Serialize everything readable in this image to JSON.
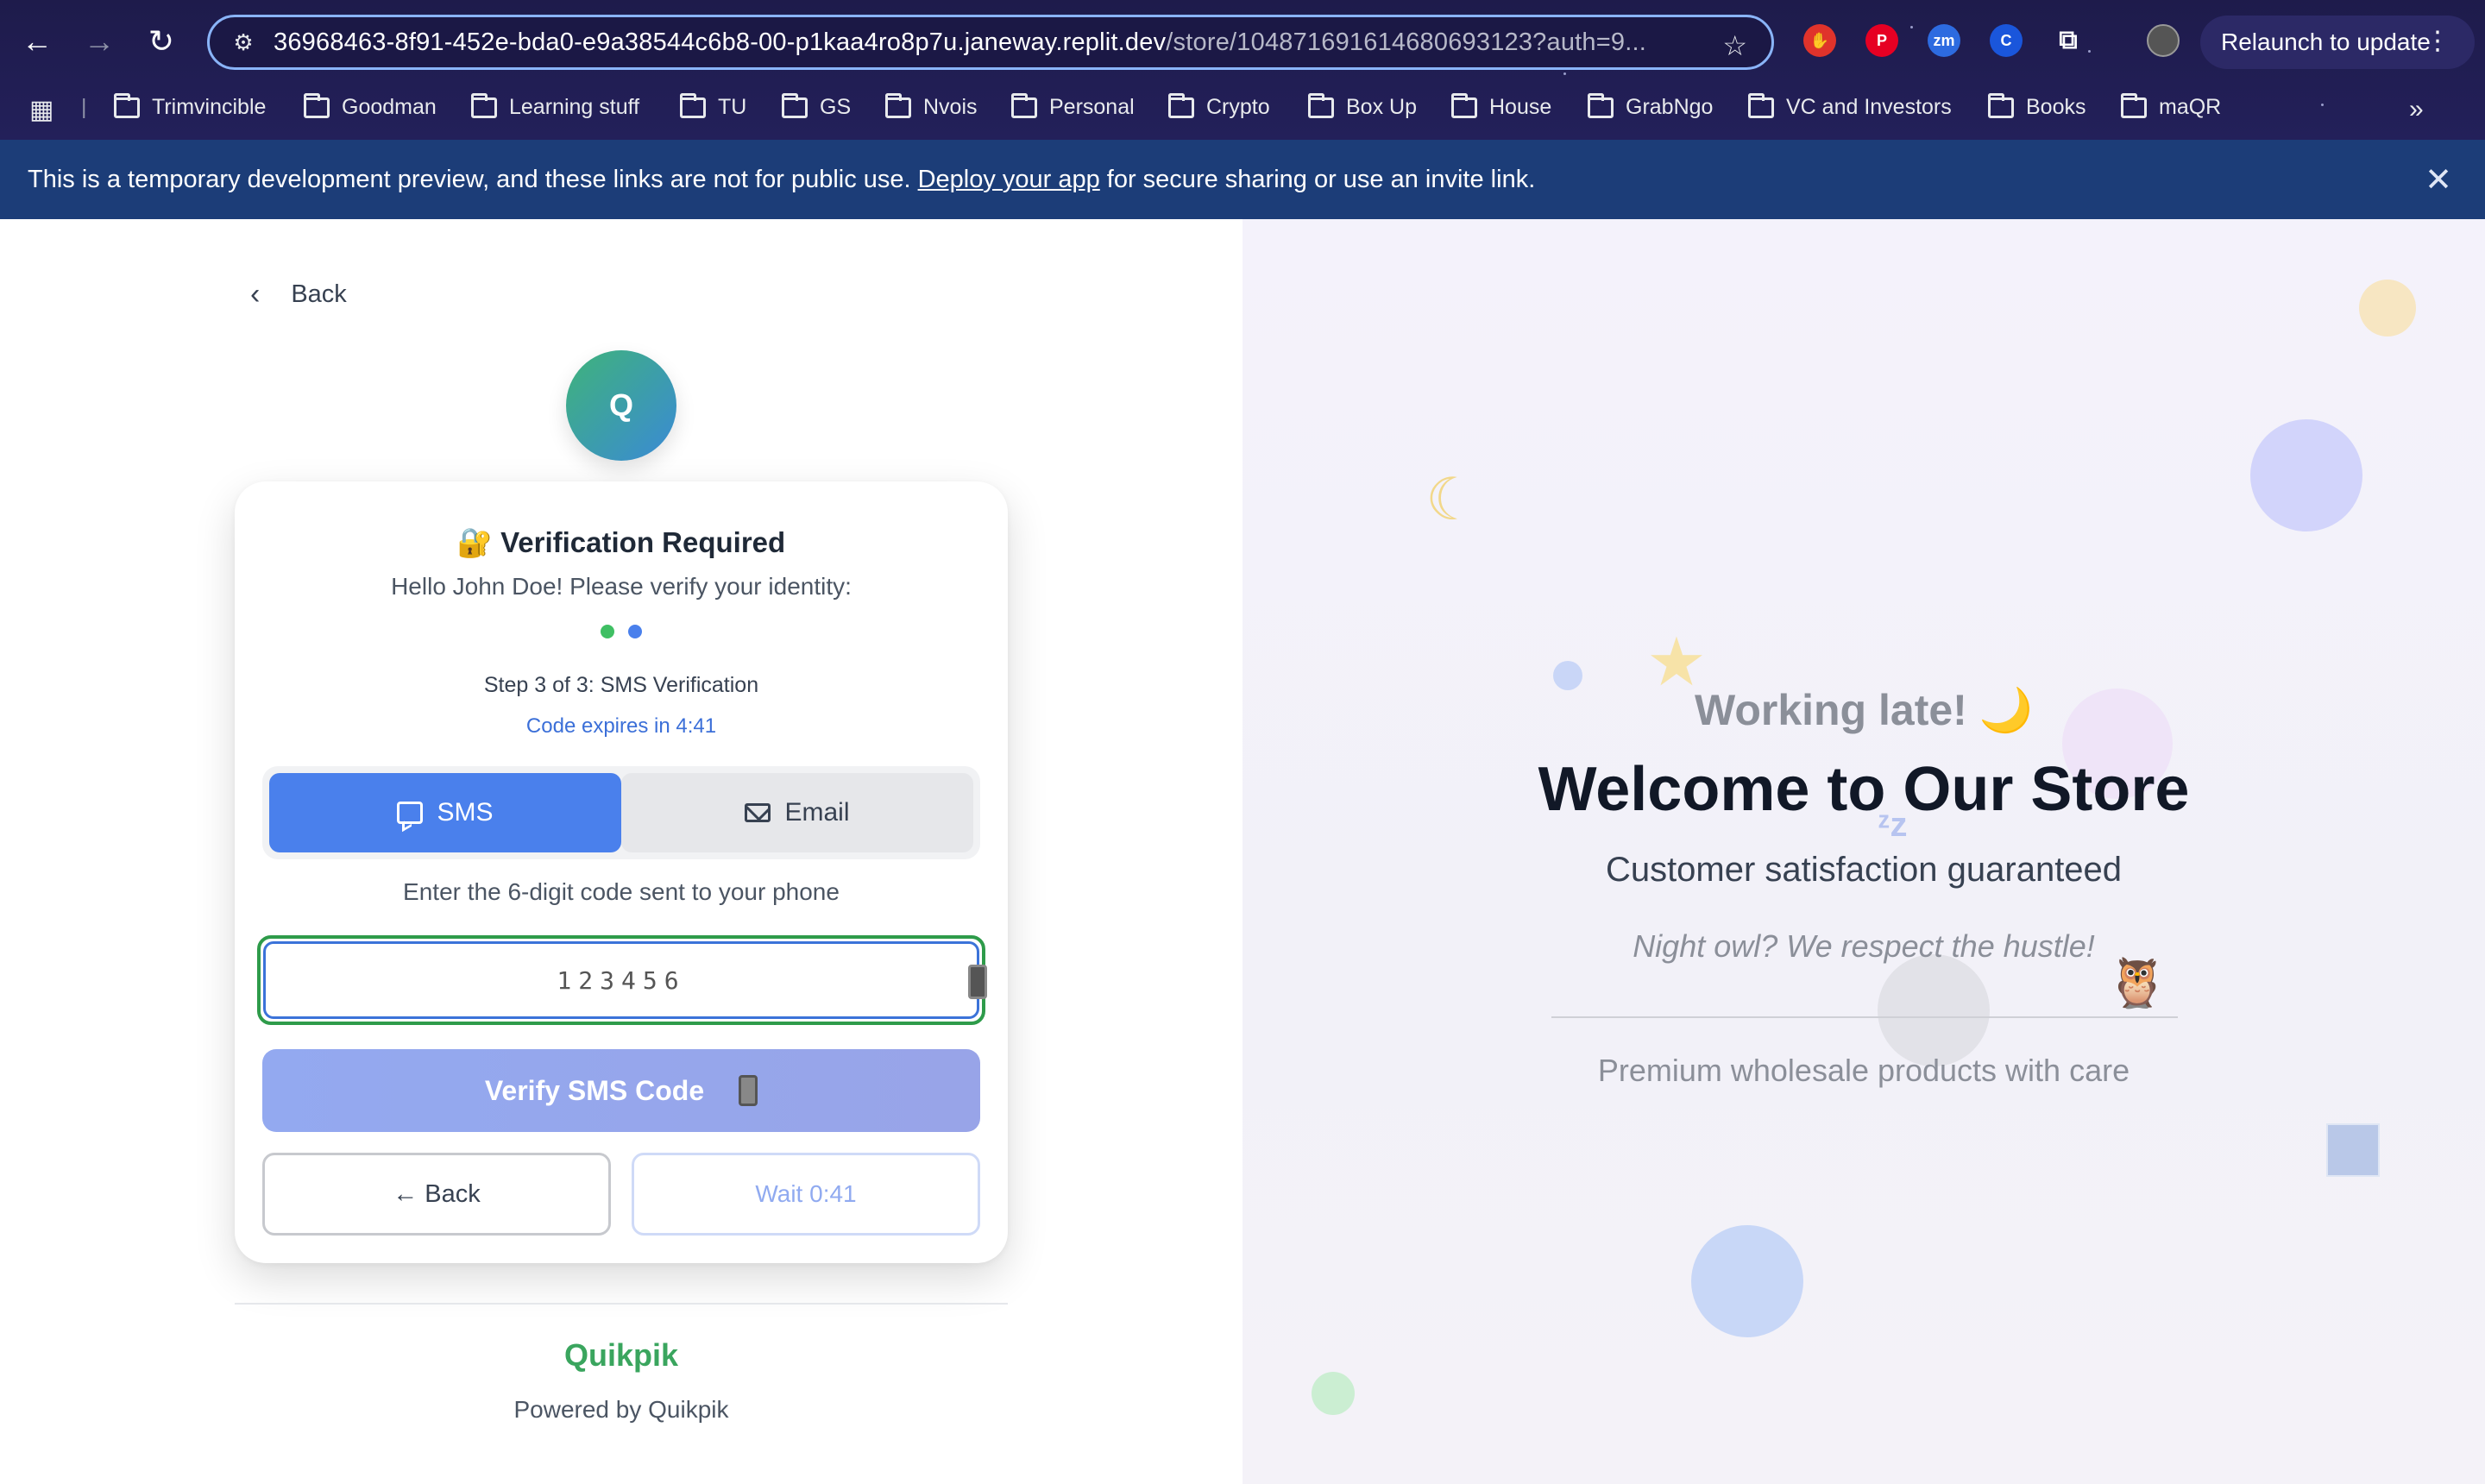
{
  "browser": {
    "url_main": "36968463-8f91-452e-bda0-e9a38544c6b8-00-p1kaa4ro8p7u.janeway.replit.dev",
    "url_rest": "/store/1048716916146806931​23?auth=9...",
    "relaunch_label": "Relaunch to update",
    "bookmarks": [
      "Trimvincible",
      "Goodman",
      "Learning stuff",
      "TU",
      "GS",
      "Nvois",
      "Personal",
      "Crypto",
      "Box Up",
      "House",
      "GrabNgo",
      "VC and Investors",
      "Books",
      "maQR"
    ],
    "extensions": {
      "zm": "zm"
    }
  },
  "banner": {
    "text_before": "This is a temporary development preview, and these links are not for public use.",
    "link": "Deploy your app",
    "text_after": "for secure sharing or use an invite link."
  },
  "left": {
    "back": "Back",
    "logo_letter": "Q",
    "card": {
      "title": "🔐 Verification Required",
      "subtitle": "Hello John Doe! Please verify your identity:",
      "step": "Step 3 of 3: SMS Verification",
      "expires": "Code expires in 4:41",
      "tab_sms": "SMS",
      "tab_email": "Email",
      "instruction": "Enter the 6-digit code sent to your phone",
      "code_placeholder": "123456",
      "verify_label": "Verify SMS Code",
      "back_label": "← Back",
      "wait_label": "Wait 0:41"
    },
    "brand": "Quikpik",
    "powered": "Powered by Quikpik"
  },
  "right": {
    "working_late": "Working late! 🌙",
    "welcome": "Welcome to Our Store",
    "satisfaction": "Customer satisfaction guaranteed",
    "night_owl": "Night owl? We respect the hustle!",
    "premium": "Premium wholesale products with care"
  },
  "colors": {
    "accent": "#4a80ec",
    "brand_green": "#3aa55e",
    "banner": "#1c3d78"
  }
}
